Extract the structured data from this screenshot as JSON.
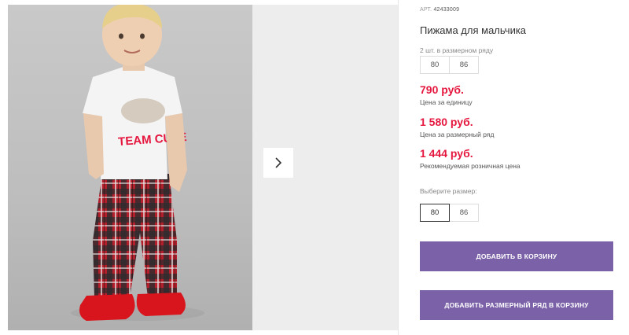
{
  "product": {
    "sku_label": "АРТ.",
    "sku_value": "42433009",
    "title": "Пижама для мальчика",
    "set_note": "2 шт. в размерном ряду",
    "set_sizes": [
      "80",
      "86"
    ]
  },
  "prices": [
    {
      "value": "790 руб.",
      "label": "Цена за единицу"
    },
    {
      "value": "1 580 руб.",
      "label": "Цена за размерный ряд"
    },
    {
      "value": "1 444 руб.",
      "label": "Рекомендуемая розничная цена"
    }
  ],
  "size_select": {
    "label": "Выберите размер:",
    "options": [
      "80",
      "86"
    ],
    "selected": "80"
  },
  "buttons": {
    "add_to_cart": "ДОБАВИТЬ В КОРЗИНУ",
    "add_size_set": "ДОБАВИТЬ РАЗМЕРНЫЙ РЯД В КОРЗИНУ"
  },
  "gallery": {
    "shirt_print": "TEAM CUTE",
    "next_icon": "chevron-right-icon"
  },
  "colors": {
    "price": "#e5173f",
    "button": "#7b62a8",
    "pants_red": "#b3202b",
    "shoe_red": "#d8151c"
  }
}
